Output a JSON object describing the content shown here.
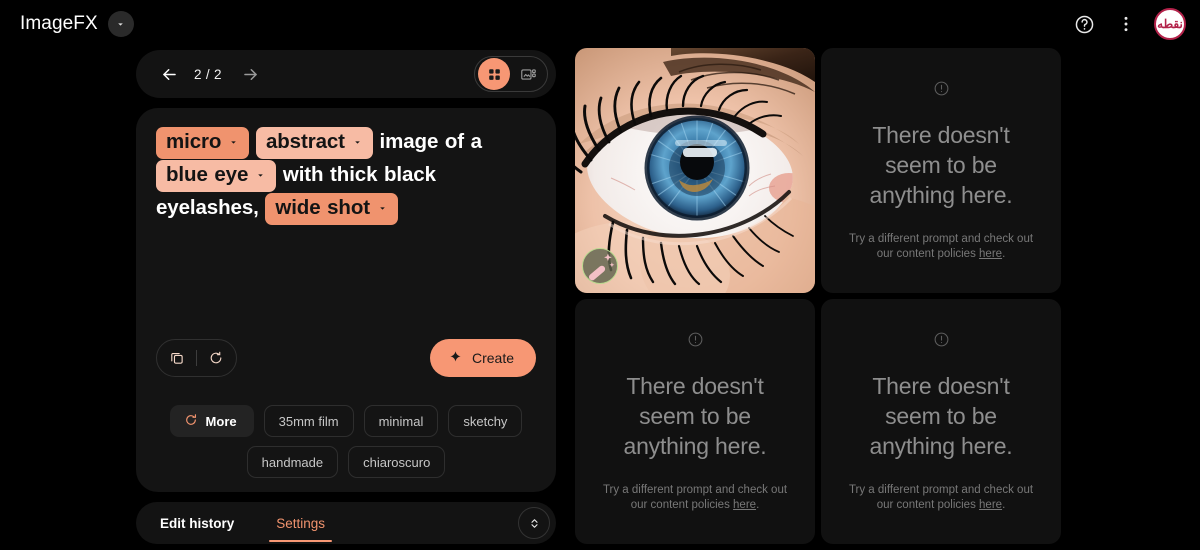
{
  "app": {
    "title": "ImageFX",
    "brand_caret_icon": "chevron-down-icon"
  },
  "topbar": {
    "help_icon": "help-circle-icon",
    "more_icon": "more-vertical-icon",
    "avatar_text": "نقطه",
    "avatar_border_color": "#b3224a"
  },
  "navbar": {
    "back_icon": "arrow-left-icon",
    "forward_icon": "arrow-right-icon",
    "counter": "2 / 2",
    "view_grid_icon": "grid-view-icon",
    "view_detail_icon": "detail-view-icon",
    "active_view": "grid"
  },
  "prompt": {
    "segments": [
      {
        "type": "chip",
        "text": "micro",
        "style": "strong",
        "caret_icon": "chevron-down-icon"
      },
      {
        "type": "chip",
        "text": "abstract",
        "style": "light",
        "caret_icon": "chevron-down-icon"
      },
      {
        "type": "text",
        "text": "image of a"
      },
      {
        "type": "chip",
        "text": "blue eye",
        "style": "light",
        "caret_icon": "chevron-down-icon"
      },
      {
        "type": "text",
        "text": "with thick black eyelashes,"
      },
      {
        "type": "chip",
        "text": "wide shot",
        "style": "strong",
        "caret_icon": "chevron-down-icon"
      }
    ],
    "copy_icon": "copy-icon",
    "reset_icon": "refresh-icon",
    "create_label": "Create",
    "create_icon": "sparkle-icon",
    "accent_color": "#f79774"
  },
  "suggestions": {
    "more_label": "More",
    "more_icon": "refresh-icon",
    "chips": [
      "35mm film",
      "minimal",
      "sketchy",
      "handmade",
      "chiaroscuro"
    ]
  },
  "tabs": {
    "items": [
      {
        "label": "Edit history",
        "active": false
      },
      {
        "label": "Settings",
        "active": true
      }
    ],
    "expand_icon": "expand-collapse-icon"
  },
  "gallery": {
    "result": {
      "alt": "macro close-up of a blue eye with thick black eyelashes",
      "edit_icon": "magic-wand-icon"
    },
    "empty_states": [
      {
        "icon": "alert-circle-icon",
        "title": "There doesn't seem to be anything here.",
        "sub_before": "Try a different prompt and check out our content policies ",
        "sub_link": "here",
        "sub_after": "."
      },
      {
        "icon": "alert-circle-icon",
        "title": "There doesn't seem to be anything here.",
        "sub_before": "Try a different prompt and check out our content policies ",
        "sub_link": "here",
        "sub_after": "."
      },
      {
        "icon": "alert-circle-icon",
        "title": "There doesn't seem to be anything here.",
        "sub_before": "Try a different prompt and check out our content policies ",
        "sub_link": "here",
        "sub_after": "."
      }
    ]
  }
}
